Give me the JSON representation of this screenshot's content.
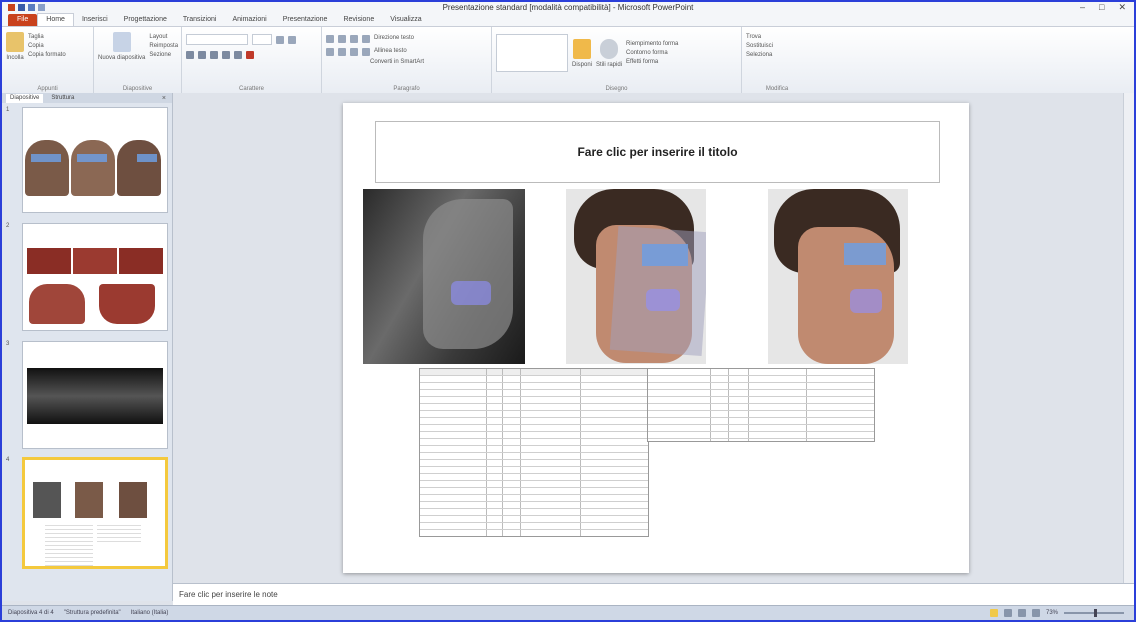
{
  "window": {
    "title": "Presentazione standard [modalità compatibilità] - Microsoft PowerPoint",
    "min": "–",
    "max": "□",
    "close": "✕"
  },
  "tabs": [
    "File",
    "Home",
    "Inserisci",
    "Progettazione",
    "Transizioni",
    "Animazioni",
    "Presentazione",
    "Revisione",
    "Visualizza"
  ],
  "ribbon": {
    "clipboard": {
      "paste": "Incolla",
      "cut": "Taglia",
      "copy": "Copia",
      "format_painter": "Copia formato",
      "label": "Appunti"
    },
    "slides": {
      "new_slide": "Nuova diapositiva",
      "layout": "Layout",
      "reset": "Reimposta",
      "section": "Sezione",
      "label": "Diapositive"
    },
    "font": {
      "label": "Carattere"
    },
    "paragraph": {
      "text_direction": "Direzione testo",
      "align_text": "Allinea testo",
      "smartart": "Converti in SmartArt",
      "label": "Paragrafo"
    },
    "drawing": {
      "arrange": "Disponi",
      "quick_styles": "Stili rapidi",
      "shape_fill": "Riempimento forma",
      "shape_outline": "Contorno forma",
      "shape_effects": "Effetti forma",
      "label": "Disegno"
    },
    "editing": {
      "find": "Trova",
      "replace": "Sostituisci",
      "select": "Seleziona",
      "label": "Modifica"
    }
  },
  "panes": {
    "tab_slides": "Diapositive",
    "tab_outline": "Struttura",
    "close": "×",
    "slide_numbers": [
      "1",
      "2",
      "3",
      "4"
    ]
  },
  "slide": {
    "title_placeholder": "Fare clic per inserire il titolo"
  },
  "notes": {
    "placeholder": "Fare clic per inserire le note"
  },
  "statusbar": {
    "slide_info": "Diapositiva 4 di 4",
    "theme": "\"Struttura predefinita\"",
    "language": "Italiano (Italia)",
    "zoom": "73%"
  },
  "colors": {
    "file_tab": "#c9421d",
    "window_border": "#2b3fd9",
    "selection": "#f4c93d",
    "censor_bar": "#6f9de0"
  }
}
